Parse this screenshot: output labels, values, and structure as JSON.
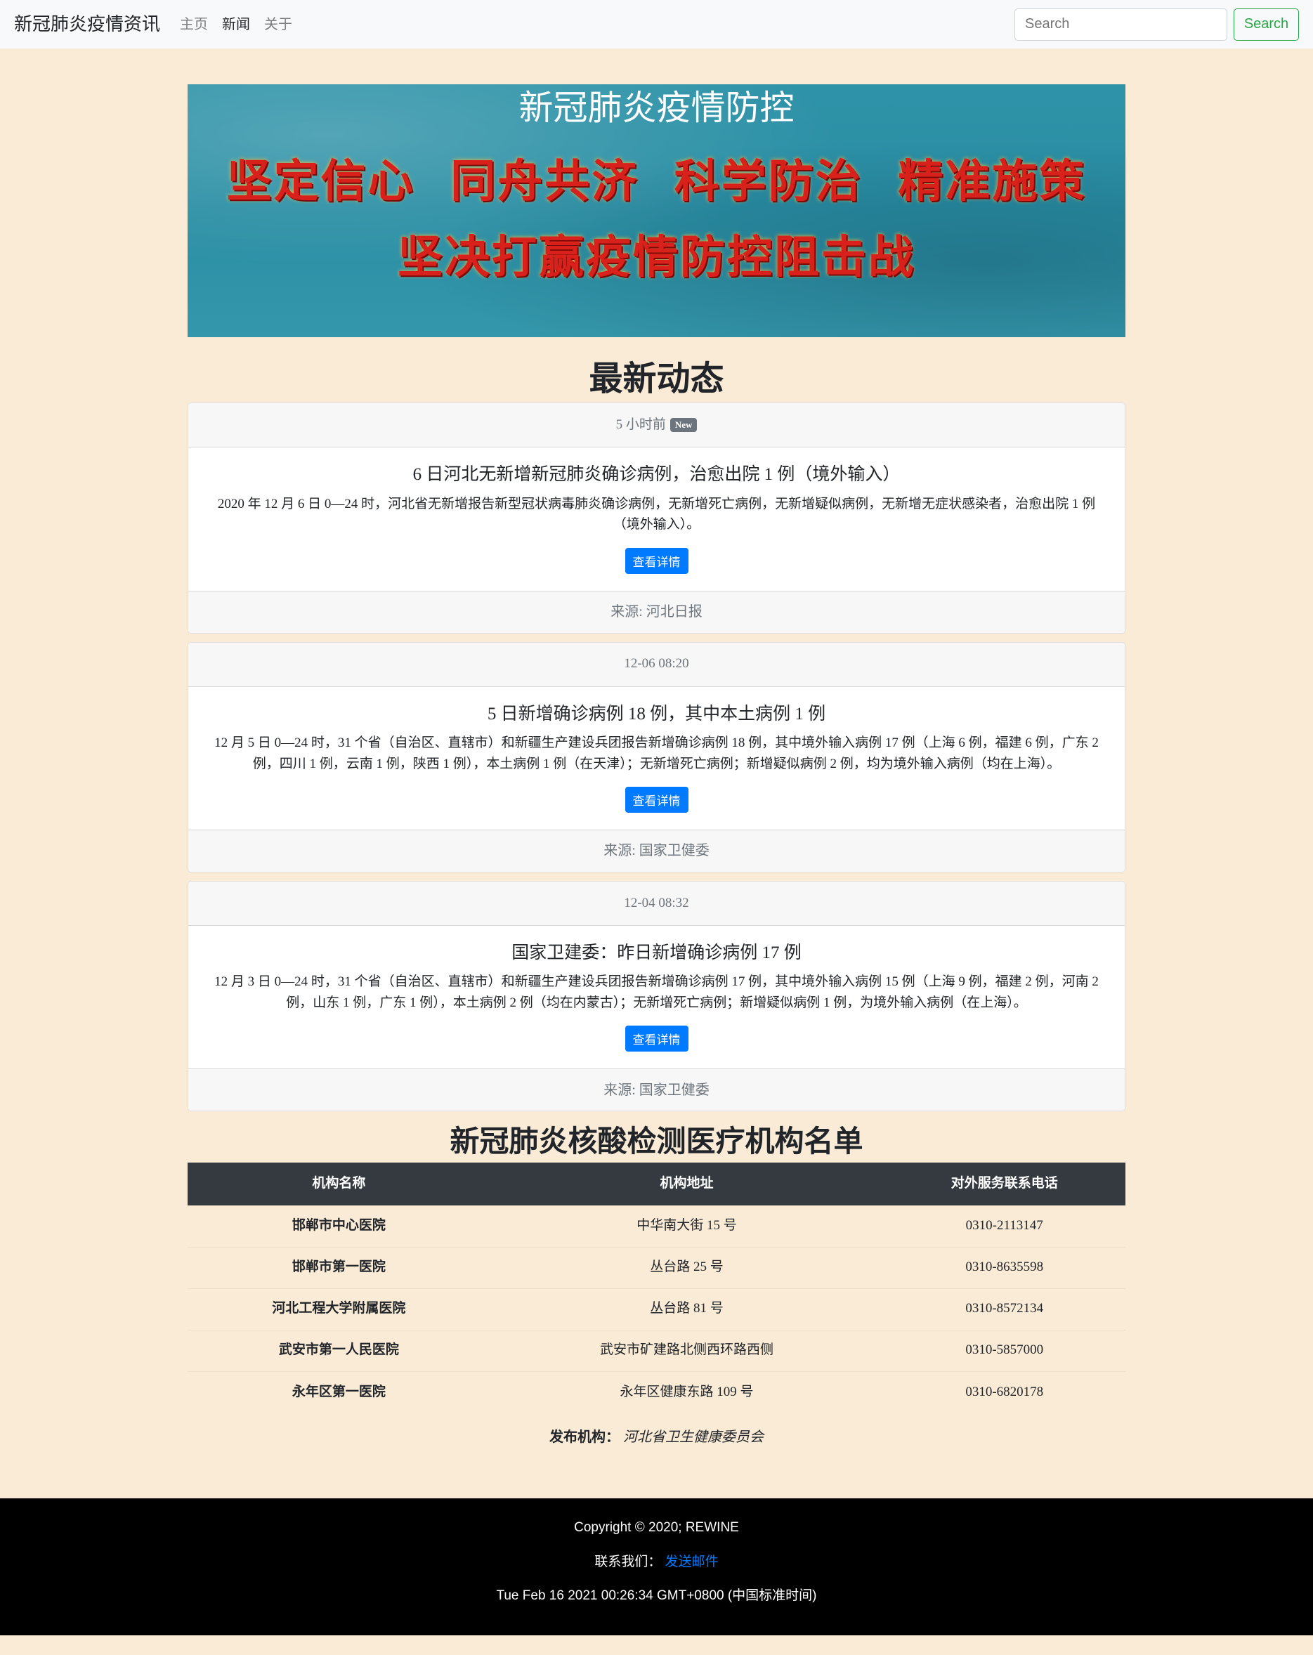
{
  "navbar": {
    "brand": "新冠肺炎疫情资讯",
    "links": [
      "主页",
      "新闻",
      "关于"
    ],
    "search_placeholder": "Search",
    "search_button": "Search"
  },
  "banner": {
    "title": "新冠肺炎疫情防控",
    "slogan_line1": "坚定信心  同舟共济  科学防治  精准施策",
    "slogan_line2": "坚决打赢疫情防控阻击战"
  },
  "news": {
    "heading": "最新动态",
    "items": [
      {
        "time": "5 小时前",
        "badge": "New",
        "title": "6 日河北无新增新冠肺炎确诊病例，治愈出院 1 例（境外输入）",
        "text": "2020 年 12 月 6 日 0—24 时，河北省无新增报告新型冠状病毒肺炎确诊病例，无新增死亡病例，无新增疑似病例，无新增无症状感染者，治愈出院 1 例（境外输入）。",
        "button": "查看详情",
        "source": "来源: 河北日报"
      },
      {
        "time": "12-06 08:20",
        "title": "5 日新增确诊病例 18 例，其中本土病例 1 例",
        "text": "12 月 5 日 0—24 时，31 个省（自治区、直辖市）和新疆生产建设兵团报告新增确诊病例 18 例，其中境外输入病例 17 例（上海 6 例，福建 6 例，广东 2 例，四川 1 例，云南 1 例，陕西 1 例），本土病例 1 例（在天津）；无新增死亡病例；新增疑似病例 2 例，均为境外输入病例（均在上海）。",
        "button": "查看详情",
        "source": "来源: 国家卫健委"
      },
      {
        "time": "12-04 08:32",
        "title": "国家卫建委：昨日新增确诊病例 17 例",
        "text": "12 月 3 日 0—24 时，31 个省（自治区、直辖市）和新疆生产建设兵团报告新增确诊病例 17 例，其中境外输入病例 15 例（上海 9 例，福建 2 例，河南 2 例，山东 1 例，广东 1 例），本土病例 2 例（均在内蒙古）；无新增死亡病例；新增疑似病例 1 例，为境外输入病例（在上海）。",
        "button": "查看详情",
        "source": "来源: 国家卫健委"
      }
    ]
  },
  "hospitals": {
    "heading": "新冠肺炎核酸检测医疗机构名单",
    "columns": [
      "机构名称",
      "机构地址",
      "对外服务联系电话"
    ],
    "rows": [
      [
        "邯郸市中心医院",
        "中华南大街 15 号",
        "0310-2113147"
      ],
      [
        "邯郸市第一医院",
        "丛台路 25 号",
        "0310-8635598"
      ],
      [
        "河北工程大学附属医院",
        "丛台路 81 号",
        "0310-8572134"
      ],
      [
        "武安市第一人民医院",
        "武安市矿建路北侧西环路西侧",
        "0310-5857000"
      ],
      [
        "永年区第一医院",
        "永年区健康东路 109 号",
        "0310-6820178"
      ]
    ],
    "publisher_label": "发布机构：",
    "publisher_name": "河北省卫生健康委员会"
  },
  "footer": {
    "copyright": "Copyright © 2020; REWINE",
    "contact_label": "联系我们：",
    "contact_link": "发送邮件",
    "datetime": "Tue Feb 16 2021 00:26:34 GMT+0800 (中国标准时间)"
  },
  "colors": {
    "page_background": "#faebd7",
    "primary": "#007bff",
    "success": "#28a745",
    "dark": "#343a40"
  }
}
